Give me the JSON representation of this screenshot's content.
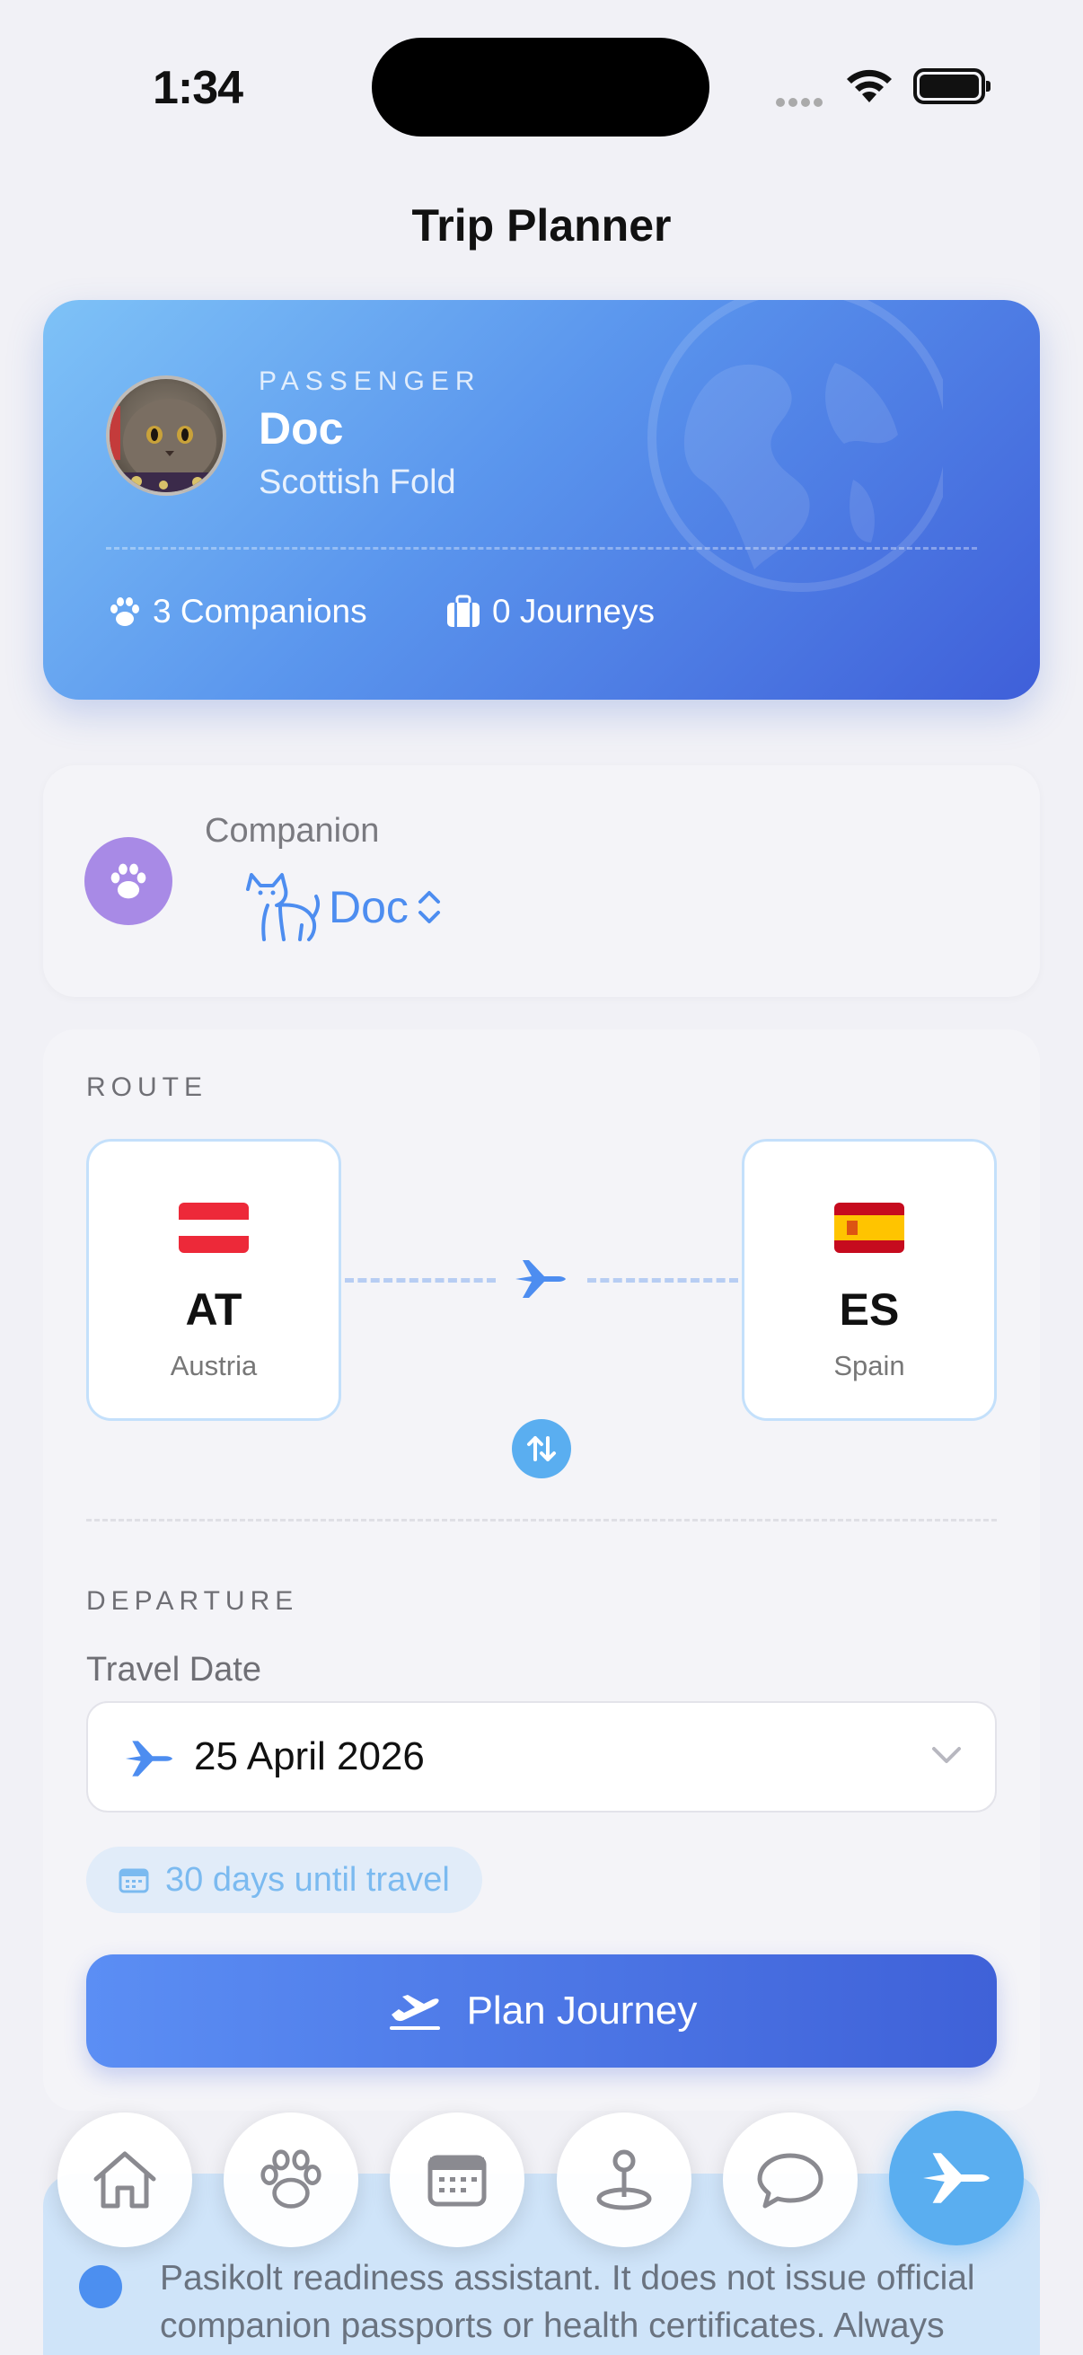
{
  "status_bar": {
    "time": "1:34"
  },
  "nav": {
    "title": "Trip Planner"
  },
  "passenger": {
    "label": "PASSENGER",
    "name": "Doc",
    "breed": "Scottish Fold",
    "companions": "3 Companions",
    "journeys": "0 Journeys"
  },
  "companion": {
    "label": "Companion",
    "selected": "Doc"
  },
  "route": {
    "label": "ROUTE",
    "origin": {
      "flag": "🇦🇹",
      "code": "AT",
      "name": "Austria"
    },
    "destination": {
      "flag": "🇪🇸",
      "code": "ES",
      "name": "Spain"
    }
  },
  "departure": {
    "label": "DEPARTURE",
    "date_label": "Travel Date",
    "date_value": "25 April 2026",
    "days_until": "30 days until travel"
  },
  "plan_button": "Plan Journey",
  "disclaimer": "Pasikolt readiness assistant. It does not issue official companion passports or health certificates. Always verify requirements with official government",
  "tabs": [
    "home",
    "companions",
    "calendar",
    "map-pin",
    "chat",
    "trip-planner"
  ],
  "colors": {
    "accent": "#4d8df0",
    "card_gradient_start": "#7ec2f7",
    "card_gradient_end": "#3f5fd9",
    "active_tab": "#5aaef0"
  }
}
